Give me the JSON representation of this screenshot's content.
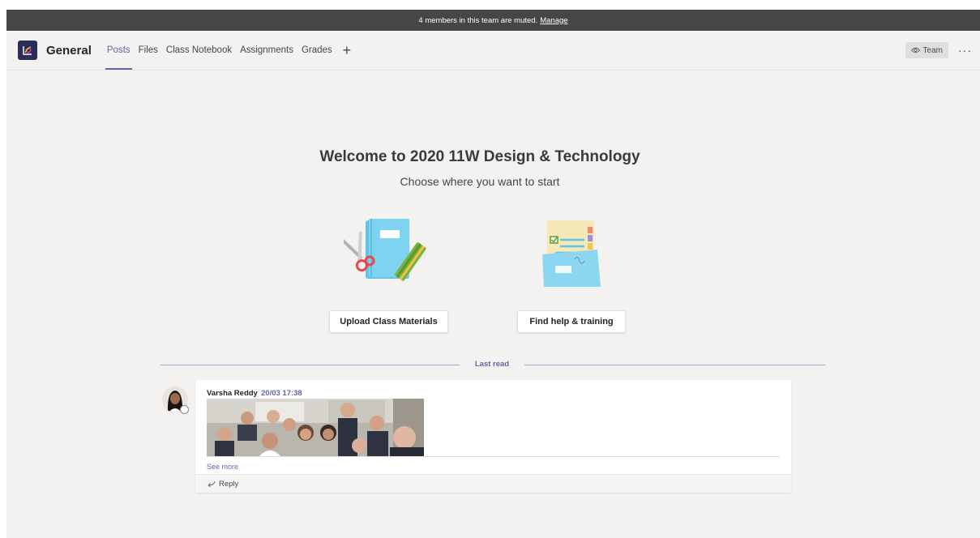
{
  "banner": {
    "text": "4 members in this team are muted.",
    "link": "Manage"
  },
  "header": {
    "channel": "General",
    "tabs": [
      "Posts",
      "Files",
      "Class Notebook",
      "Assignments",
      "Grades"
    ],
    "active_tab": "Posts",
    "add_tab_icon": "plus-icon",
    "team_button": "Team",
    "more_icon": "ellipsis-icon"
  },
  "welcome": {
    "title": "Welcome to 2020 11W Design & Technology",
    "subtitle": "Choose where you want to start",
    "upload_button": "Upload Class Materials",
    "help_button": "Find help & training"
  },
  "divider": {
    "label": "Last read"
  },
  "post": {
    "author": "Varsha Reddy",
    "time": "20/03 17:38",
    "see_more": "See more",
    "reply": "Reply"
  },
  "colors": {
    "accent": "#6264a7",
    "banner": "#464646",
    "background": "#f3f2f1"
  }
}
